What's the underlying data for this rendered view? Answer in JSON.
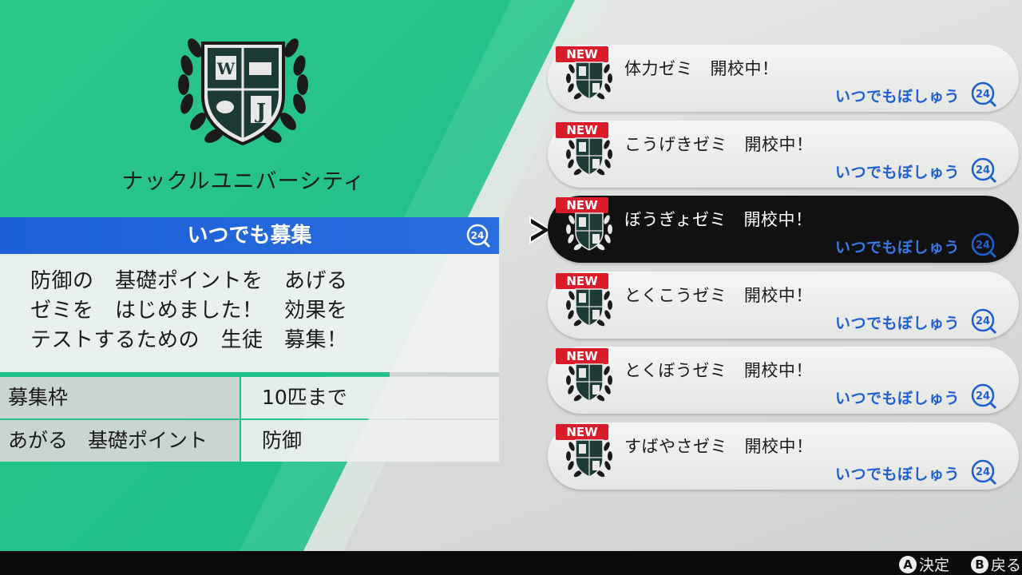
{
  "school": {
    "name": "ナックルユニバーシティ",
    "emblem_icon": "laurel-shield-emblem-icon"
  },
  "recruitment": {
    "header": "いつでも募集",
    "header_icon": "clock-24-icon",
    "description": [
      "防御の　基礎ポイントを　あげる",
      "ゼミを　はじめました！　効果を",
      "テストするための　生徒　募集！"
    ],
    "progress_fraction": 0.78,
    "info": [
      {
        "key": "募集枠",
        "value": "10匹まで"
      },
      {
        "key": "あがる　基礎ポイント",
        "value": "防御"
      }
    ]
  },
  "courses": [
    {
      "badge": "NEW",
      "title": "体力ゼミ　開校中！",
      "status": "いつでもぼしゅう",
      "selected": false
    },
    {
      "badge": "NEW",
      "title": "こうげきゼミ　開校中！",
      "status": "いつでもぼしゅう",
      "selected": false
    },
    {
      "badge": "NEW",
      "title": "ぼうぎょゼミ　開校中！",
      "status": "いつでもぼしゅう",
      "selected": true
    },
    {
      "badge": "NEW",
      "title": "とくこうゼミ　開校中！",
      "status": "いつでもぼしゅう",
      "selected": false
    },
    {
      "badge": "NEW",
      "title": "とくぼうゼミ　開校中！",
      "status": "いつでもぼしゅう",
      "selected": false
    },
    {
      "badge": "NEW",
      "title": "すばやさゼミ　開校中！",
      "status": "いつでもぼしゅう",
      "selected": false
    }
  ],
  "controls": {
    "confirm_button": "A",
    "confirm_label": "決定",
    "back_button": "B",
    "back_label": "戻る"
  },
  "colors": {
    "accent_green": "#22c08a",
    "header_blue": "#1c5fd6",
    "new_red": "#d81c2a",
    "status_blue": "#1f5fd0"
  }
}
